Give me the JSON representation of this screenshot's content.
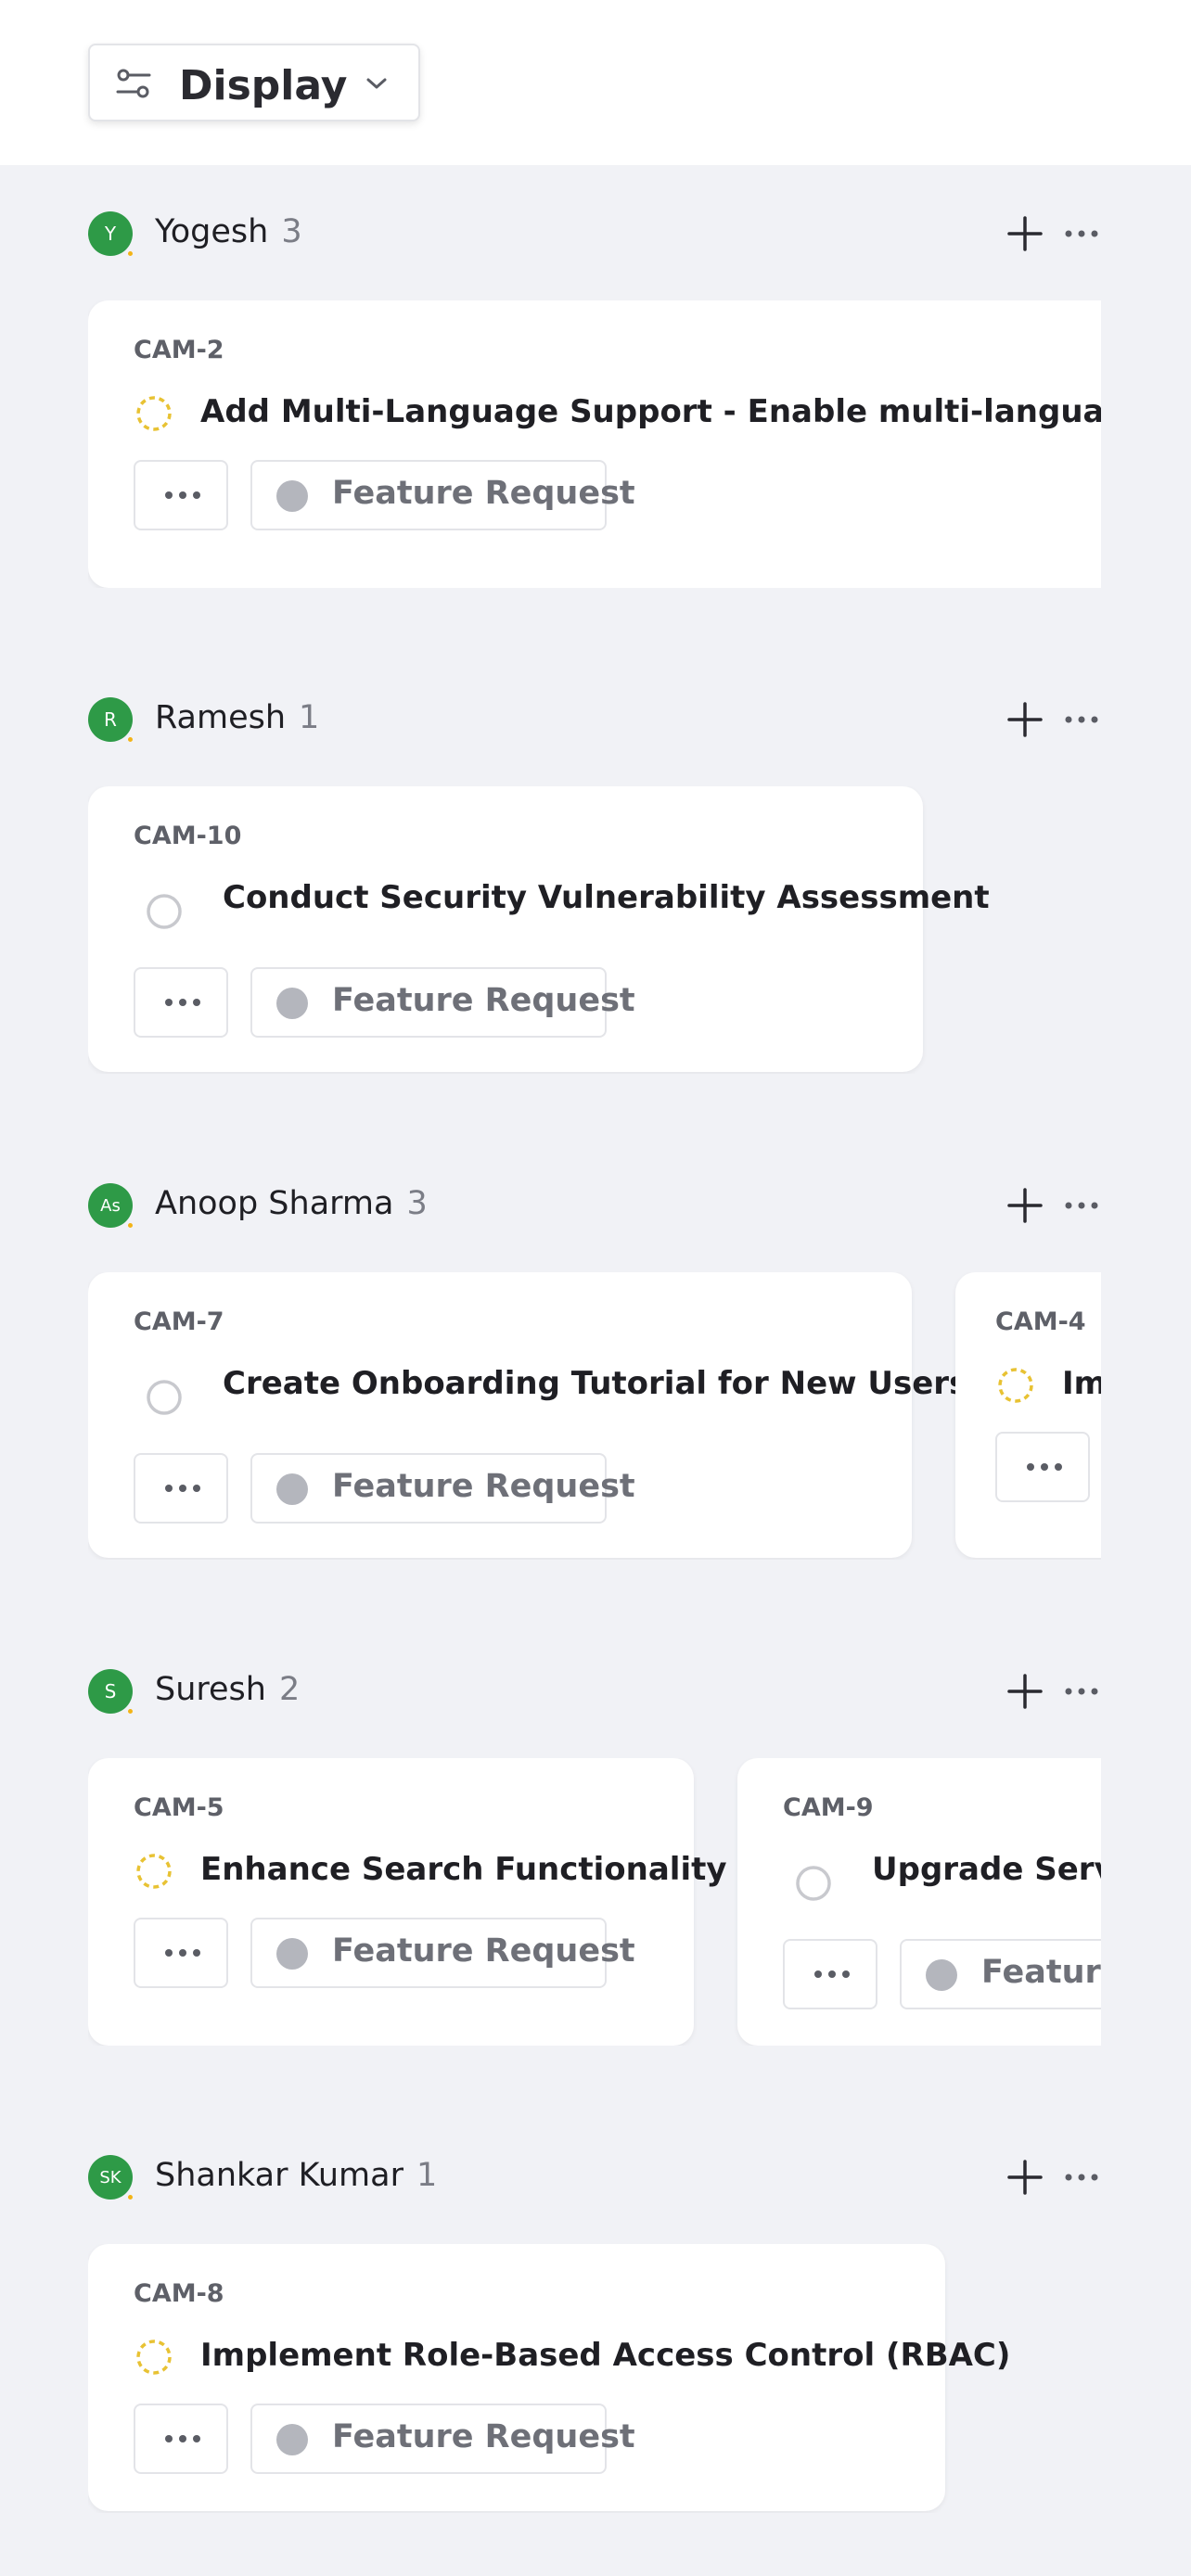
{
  "toolbar": {
    "display_label": "Display",
    "display_icon": "filter-sliders-icon",
    "dropdown_icon": "chevron-down-icon"
  },
  "colors": {
    "avatar_bg": "#2e9a47",
    "status_in_progress": "#e8c233",
    "status_todo": "#c8c9ce",
    "label_dot": "#b4b6bd",
    "page_bg": "#f1f2f6"
  },
  "groups": [
    {
      "name": "Yogesh",
      "initials": "Y",
      "count": "3",
      "cards": [
        {
          "id": "CAM-2",
          "status": "in-progress",
          "title": "Add Multi-Language Support - Enable multi-language support for the application",
          "label": "Feature Request"
        }
      ]
    },
    {
      "name": "Ramesh",
      "initials": "R",
      "count": "1",
      "cards": [
        {
          "id": "CAM-10",
          "status": "todo",
          "title": "Conduct Security Vulnerability Assessment",
          "label": "Feature Request"
        }
      ]
    },
    {
      "name": "Anoop Sharma",
      "initials": "As",
      "count": "3",
      "cards": [
        {
          "id": "CAM-7",
          "status": "todo",
          "title": "Create Onboarding Tutorial for New Users",
          "label": "Feature Request"
        },
        {
          "id": "CAM-4",
          "status": "in-progress",
          "title": "Im",
          "label": ""
        }
      ]
    },
    {
      "name": "Suresh",
      "initials": "S",
      "count": "2",
      "cards": [
        {
          "id": "CAM-5",
          "status": "in-progress",
          "title": "Enhance Search Functionality",
          "label": "Feature Request"
        },
        {
          "id": "CAM-9",
          "status": "todo",
          "title": "Upgrade Server",
          "label": "Feature Request"
        }
      ]
    },
    {
      "name": "Shankar Kumar",
      "initials": "SK",
      "count": "1",
      "cards": [
        {
          "id": "CAM-8",
          "status": "in-progress",
          "title": "Implement Role-Based Access Control (RBAC)",
          "label": "Feature Request"
        }
      ]
    }
  ]
}
